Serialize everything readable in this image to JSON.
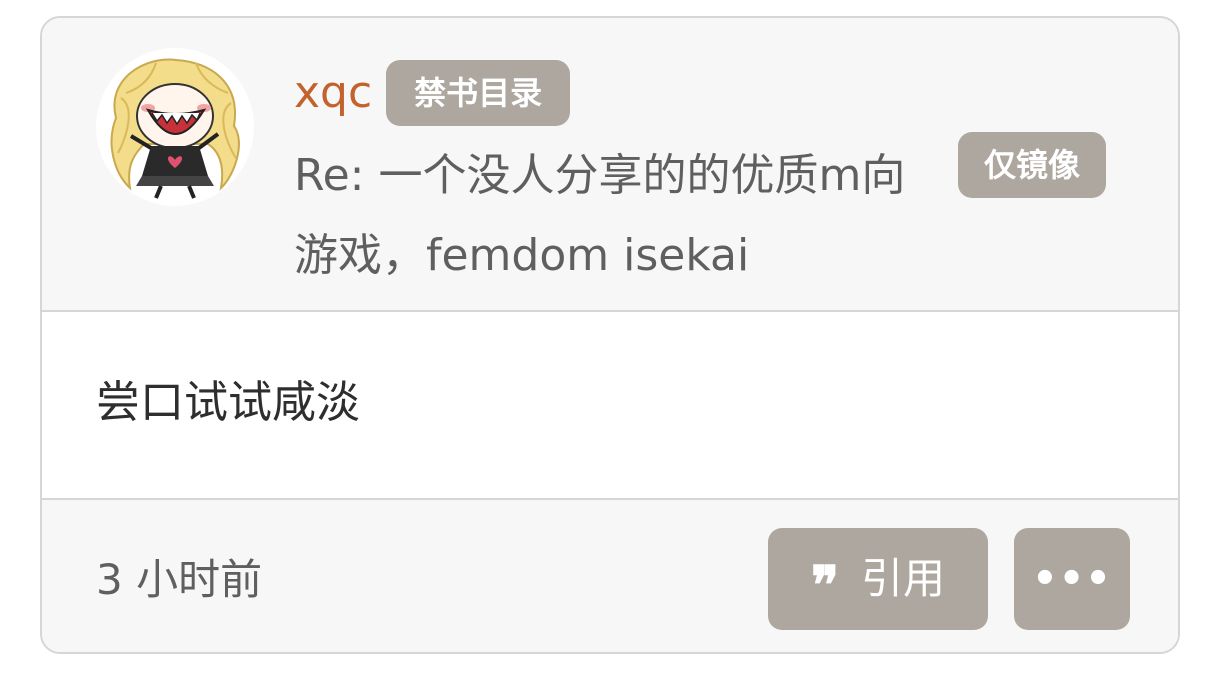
{
  "post": {
    "username": "xqc",
    "group_badge": "禁书目录",
    "title": "Re: 一个没人分享的的优质m向游戏，femdom isekai",
    "mirror_badge": "仅镜像",
    "content": "尝口试试咸淡",
    "time": "3 小时前"
  },
  "actions": {
    "quote_icon": "quote-icon",
    "quote_symbol": "❞",
    "quote_label": "引用",
    "more_icon": "more-icon",
    "more_symbol": "•••"
  },
  "colors": {
    "username": "#c4622d",
    "badge_bg": "#ada79f",
    "card_bg": "#f7f7f7",
    "border": "#d6d6d6"
  }
}
